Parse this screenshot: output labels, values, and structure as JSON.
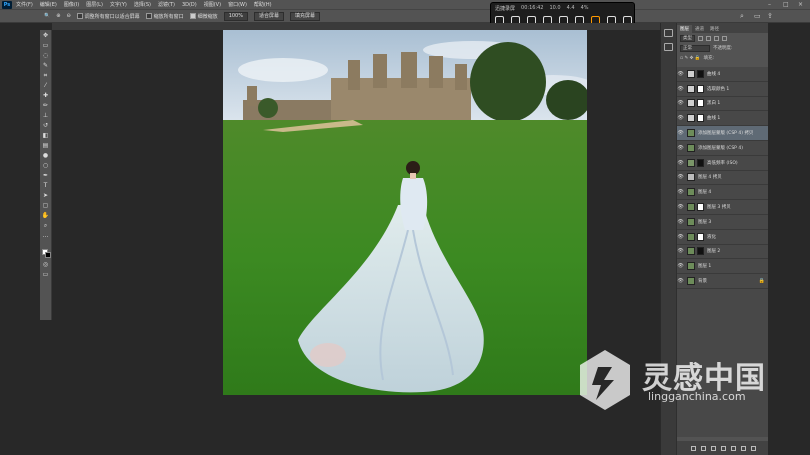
{
  "app": {
    "logo": "Ps",
    "menu": [
      "文件(F)",
      "编辑(E)",
      "图像(I)",
      "图层(L)",
      "文字(Y)",
      "选择(S)",
      "滤镜(T)",
      "3D(D)",
      "视图(V)",
      "窗口(W)",
      "帮助(H)"
    ],
    "window_controls": [
      "–",
      "□",
      "×"
    ]
  },
  "recorder": {
    "title": "迅捷录屏",
    "stats": [
      "00:16:42",
      "10.0",
      "4.4",
      "4%"
    ],
    "icons": [
      "monitor-icon",
      "camera-icon",
      "screen-icon",
      "gift-icon",
      "mic-off-icon",
      "mic-icon",
      "record-icon",
      "settings-icon",
      "gear-icon"
    ]
  },
  "options": {
    "items": [
      {
        "label": "调整所有窗口以适合屏幕",
        "checked": false
      },
      {
        "label": "缩放所有窗口",
        "checked": false
      },
      {
        "label": "细微缩放",
        "checked": true
      }
    ],
    "zoom": "100%",
    "fit_screen": "适合屏幕",
    "fill_screen": "填充屏幕"
  },
  "layers_panel": {
    "tabs": [
      "图层",
      "通道",
      "路径"
    ],
    "filter": "类型",
    "blend": "正常",
    "opacity_label": "不透明度:",
    "fill_label": "填充:",
    "layers": [
      {
        "name": "曲线 4",
        "thumb": "#cfcfcf",
        "mask": "#111",
        "selected": false,
        "lock": ""
      },
      {
        "name": "选取颜色 1",
        "thumb": "#cfcfcf",
        "mask": "#fff",
        "selected": false,
        "lock": ""
      },
      {
        "name": "黑白 1",
        "thumb": "#cfcfcf",
        "mask": "#fff",
        "selected": false,
        "lock": ""
      },
      {
        "name": "曲线 1",
        "thumb": "#cfcfcf",
        "mask": "#fff",
        "selected": false,
        "lock": ""
      },
      {
        "name": "添加图层蒙版 (CSP 4) 拷贝",
        "thumb": "#6d8c5a",
        "mask": "",
        "selected": true,
        "lock": ""
      },
      {
        "name": "添加图层蒙版 (CSP 4)",
        "thumb": "#6d8c5a",
        "mask": "",
        "selected": false,
        "lock": ""
      },
      {
        "name": "高低频率 (ISO)",
        "thumb": "#7a9568",
        "mask": "#111",
        "selected": false,
        "lock": ""
      },
      {
        "name": "图层 4 拷贝",
        "thumb": "#bbbbbb",
        "mask": "",
        "selected": false,
        "lock": ""
      },
      {
        "name": "图层 4",
        "thumb": "#6d8c5a",
        "mask": "",
        "selected": false,
        "lock": ""
      },
      {
        "name": "图层 3 拷贝",
        "thumb": "#6d8c5a",
        "mask": "#fff",
        "selected": false,
        "lock": ""
      },
      {
        "name": "图层 3",
        "thumb": "#6d8c5a",
        "mask": "",
        "selected": false,
        "lock": ""
      },
      {
        "name": "液化",
        "thumb": "#6d8c5a",
        "mask": "#fff",
        "selected": false,
        "lock": ""
      },
      {
        "name": "图层 2",
        "thumb": "#6d8c5a",
        "mask": "#111",
        "selected": false,
        "lock": ""
      },
      {
        "name": "图层 1",
        "thumb": "#6d8c5a",
        "mask": "",
        "selected": false,
        "lock": ""
      },
      {
        "name": "背景",
        "thumb": "#6d8c5a",
        "mask": "",
        "selected": false,
        "lock": "🔒"
      }
    ]
  },
  "watermark": {
    "title": "灵感中国",
    "url": "lingganchina.com"
  }
}
